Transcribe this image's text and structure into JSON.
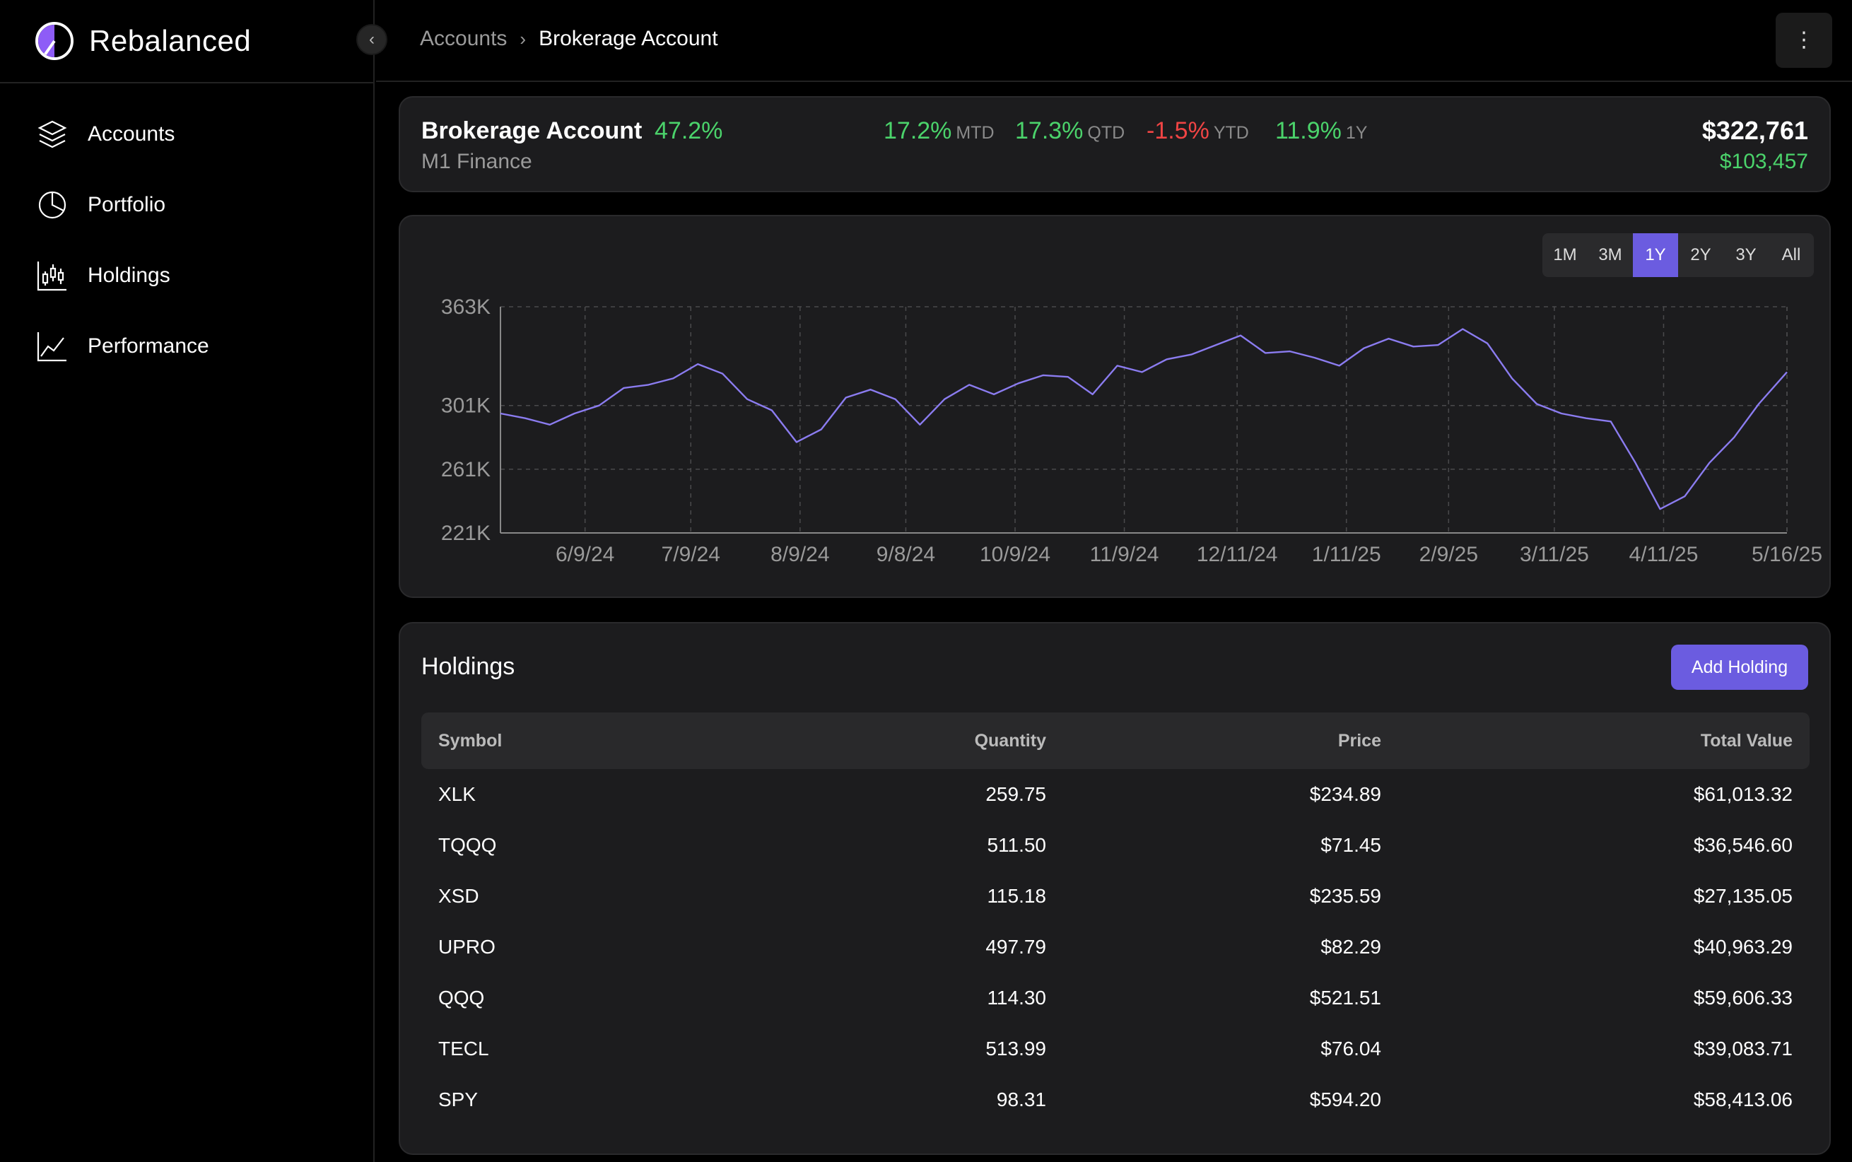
{
  "app": {
    "name": "Rebalanced"
  },
  "sidebar": {
    "items": [
      {
        "label": "Accounts",
        "icon": "layers-icon"
      },
      {
        "label": "Portfolio",
        "icon": "pie-chart-icon"
      },
      {
        "label": "Holdings",
        "icon": "candlestick-icon"
      },
      {
        "label": "Performance",
        "icon": "line-chart-icon"
      }
    ]
  },
  "breadcrumb": {
    "parent": "Accounts",
    "separator": "›",
    "current": "Brokerage Account"
  },
  "summary": {
    "name": "Brokerage Account",
    "return_pct": "47.2%",
    "institution": "M1 Finance",
    "metrics": [
      {
        "value": "17.2%",
        "label": "MTD",
        "tone": "pos"
      },
      {
        "value": "17.3%",
        "label": "QTD",
        "tone": "pos"
      },
      {
        "value": "-1.5%",
        "label": "YTD",
        "tone": "neg"
      },
      {
        "value": "11.9%",
        "label": "1Y",
        "tone": "pos"
      }
    ],
    "total_value": "$322,761",
    "gain": "$103,457"
  },
  "range_tabs": [
    "1M",
    "3M",
    "1Y",
    "2Y",
    "3Y",
    "All"
  ],
  "range_selected": "1Y",
  "colors": {
    "accent": "#6b5ce0",
    "line": "#8b7cf0",
    "positive": "#4bd36b",
    "negative": "#ef4444"
  },
  "chart_data": {
    "type": "line",
    "ylim": [
      221000,
      363000
    ],
    "y_ticks": [
      221000,
      261000,
      301000,
      363000
    ],
    "y_tick_labels": [
      "221K",
      "261K",
      "301K",
      "363K"
    ],
    "x_tick_labels": [
      "6/9/24",
      "7/9/24",
      "8/9/24",
      "9/8/24",
      "10/9/24",
      "11/9/24",
      "12/11/24",
      "1/11/25",
      "2/9/25",
      "3/11/25",
      "4/11/25",
      "5/16/25"
    ],
    "x_tick_dates": [
      "2024-06-09",
      "2024-07-09",
      "2024-08-09",
      "2024-09-08",
      "2024-10-09",
      "2024-11-09",
      "2024-12-11",
      "2025-01-11",
      "2025-02-09",
      "2025-03-11",
      "2025-04-11",
      "2025-05-16"
    ],
    "grid": true,
    "series": [
      {
        "x": [
          "2024-05-16",
          "2024-05-23",
          "2024-05-30",
          "2024-06-06",
          "2024-06-13",
          "2024-06-20",
          "2024-06-27",
          "2024-07-04",
          "2024-07-11",
          "2024-07-18",
          "2024-07-25",
          "2024-08-01",
          "2024-08-08",
          "2024-08-15",
          "2024-08-22",
          "2024-08-29",
          "2024-09-05",
          "2024-09-12",
          "2024-09-19",
          "2024-09-26",
          "2024-10-03",
          "2024-10-10",
          "2024-10-17",
          "2024-10-24",
          "2024-10-31",
          "2024-11-07",
          "2024-11-14",
          "2024-11-21",
          "2024-11-28",
          "2024-12-05",
          "2024-12-12",
          "2024-12-19",
          "2024-12-26",
          "2025-01-02",
          "2025-01-09",
          "2025-01-16",
          "2025-01-23",
          "2025-01-30",
          "2025-02-06",
          "2025-02-13",
          "2025-02-20",
          "2025-02-27",
          "2025-03-06",
          "2025-03-13",
          "2025-03-20",
          "2025-03-27",
          "2025-04-03",
          "2025-04-10",
          "2025-04-17",
          "2025-04-24",
          "2025-05-01",
          "2025-05-08",
          "2025-05-16"
        ],
        "y": [
          296000,
          293000,
          289000,
          296000,
          301000,
          312000,
          314000,
          318000,
          327000,
          321000,
          305000,
          298000,
          278000,
          286000,
          306000,
          311000,
          305000,
          289000,
          305000,
          314000,
          308000,
          315000,
          320000,
          319000,
          308000,
          326000,
          322000,
          330000,
          333000,
          339000,
          345000,
          334000,
          335000,
          331000,
          326000,
          337000,
          343000,
          338000,
          339000,
          349000,
          340000,
          318000,
          302000,
          296000,
          293000,
          291000,
          265000,
          236000,
          244000,
          265000,
          281000,
          302000,
          322000
        ]
      }
    ]
  },
  "holdings": {
    "title": "Holdings",
    "add_label": "Add Holding",
    "columns": [
      "Symbol",
      "Quantity",
      "Price",
      "Total Value"
    ],
    "rows": [
      [
        "XLK",
        "259.75",
        "$234.89",
        "$61,013.32"
      ],
      [
        "TQQQ",
        "511.50",
        "$71.45",
        "$36,546.60"
      ],
      [
        "XSD",
        "115.18",
        "$235.59",
        "$27,135.05"
      ],
      [
        "UPRO",
        "497.79",
        "$82.29",
        "$40,963.29"
      ],
      [
        "QQQ",
        "114.30",
        "$521.51",
        "$59,606.33"
      ],
      [
        "TECL",
        "513.99",
        "$76.04",
        "$39,083.71"
      ],
      [
        "SPY",
        "98.31",
        "$594.20",
        "$58,413.06"
      ]
    ]
  }
}
